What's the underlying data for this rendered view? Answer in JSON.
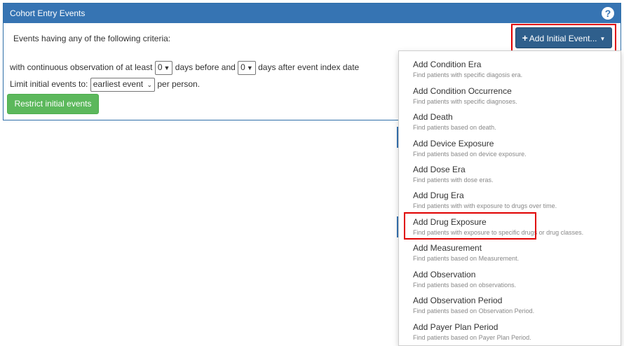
{
  "panel": {
    "title": "Cohort Entry Events",
    "help_icon": "question-circle-icon",
    "criteria_text": "Events having any of the following criteria:",
    "add_button_label": "Add Initial Event...",
    "add_button_icon": "plus-icon",
    "observation": {
      "prefix": "with continuous observation of at least",
      "days_before_value": "0",
      "middle": "days before and",
      "days_after_value": "0",
      "suffix": "days after event index date"
    },
    "limit": {
      "prefix": "Limit initial events to:",
      "value": "earliest event",
      "suffix": "per person."
    },
    "restrict_button_label": "Restrict initial events"
  },
  "dropdown": {
    "items": [
      {
        "label": "Add Condition Era",
        "desc": "Find patients with specific diagosis era."
      },
      {
        "label": "Add Condition Occurrence",
        "desc": "Find patients with specific diagnoses."
      },
      {
        "label": "Add Death",
        "desc": "Find patients based on death."
      },
      {
        "label": "Add Device Exposure",
        "desc": "Find patients based on device exposure."
      },
      {
        "label": "Add Dose Era",
        "desc": "Find patients with dose eras."
      },
      {
        "label": "Add Drug Era",
        "desc": "Find patients with with exposure to drugs over time."
      },
      {
        "label": "Add Drug Exposure",
        "desc": "Find patients with exposure to specific drugs or drug classes."
      },
      {
        "label": "Add Measurement",
        "desc": "Find patients based on Measurement."
      },
      {
        "label": "Add Observation",
        "desc": "Find patients based on observations."
      },
      {
        "label": "Add Observation Period",
        "desc": "Find patients based on Observation Period."
      },
      {
        "label": "Add Payer Plan Period",
        "desc": "Find patients based on Payer Plan Period."
      }
    ]
  },
  "colors": {
    "header_blue": "#3674b3",
    "button_dark_blue": "#2f5f8c",
    "success_green": "#5cb85c",
    "highlight_red": "#e00000"
  }
}
